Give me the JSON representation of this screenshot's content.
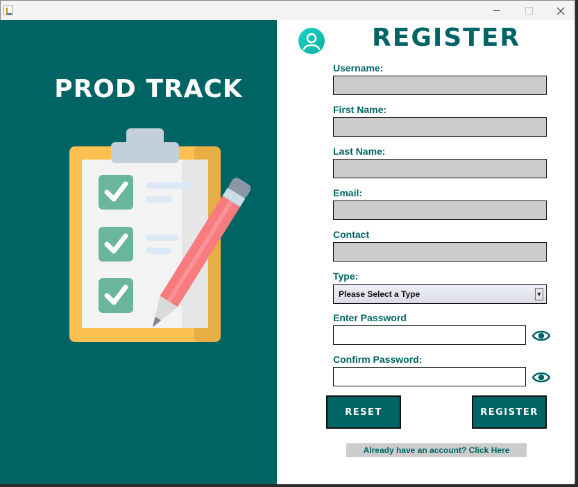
{
  "window": {
    "app_icon": "java-icon",
    "controls": [
      "minimize",
      "maximize",
      "close"
    ]
  },
  "brand": {
    "title": "PROD TRACK",
    "illustration": "clipboard-checklist-pencil"
  },
  "form": {
    "heading": "REGISTER",
    "avatar_icon": "user-icon",
    "fields": {
      "username": {
        "label": "Username:",
        "value": ""
      },
      "first_name": {
        "label": "First Name:",
        "value": ""
      },
      "last_name": {
        "label": "Last Name:",
        "value": ""
      },
      "email": {
        "label": "Email:",
        "value": ""
      },
      "contact": {
        "label": "Contact",
        "value": ""
      },
      "type": {
        "label": "Type:",
        "selected": "Please Select a Type"
      },
      "password": {
        "label": "Enter Password",
        "value": ""
      },
      "confirm_password": {
        "label": "Confirm Password:",
        "value": ""
      }
    },
    "buttons": {
      "reset": "RESET",
      "register": "REGISTER"
    },
    "login_link": "Already have an account? Click Here"
  },
  "colors": {
    "primary": "#006464",
    "field_bg": "#cccccc",
    "clipboard": "#fbc04f",
    "check": "#6ab59d",
    "pencil": "#f87c7f"
  }
}
